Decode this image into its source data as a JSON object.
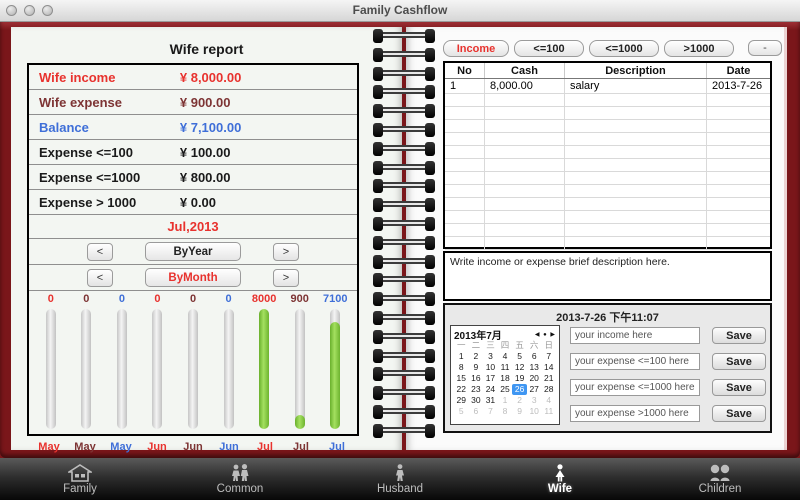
{
  "window": {
    "title": "Family Cashflow"
  },
  "left_page": {
    "title": "Wife report",
    "report_rows": [
      {
        "label": "Wife income",
        "value": "¥ 8,000.00",
        "color": "#e8322e"
      },
      {
        "label": "Wife expense",
        "value": "¥ 900.00",
        "color": "#7d3434"
      },
      {
        "label": "Balance",
        "value": "¥ 7,100.00",
        "color": "#3f6fd8"
      },
      {
        "label": "Expense  <=100",
        "value": "¥ 100.00",
        "color": "#1a1a1a"
      },
      {
        "label": "Expense  <=1000",
        "value": "¥ 800.00",
        "color": "#1a1a1a"
      },
      {
        "label": "Expense  > 1000",
        "value": "¥ 0.00",
        "color": "#1a1a1a"
      }
    ],
    "period_label": "Jul,2013",
    "by_year": {
      "prev": "<",
      "label": "ByYear",
      "next": ">"
    },
    "by_month": {
      "prev": "<",
      "label": "ByMonth",
      "next": ">"
    }
  },
  "chart_data": {
    "type": "bar",
    "categories": [
      "May",
      "May",
      "May",
      "Jun",
      "Jun",
      "Jun",
      "Jul",
      "Jul",
      "Jul"
    ],
    "roles": [
      "income",
      "expense",
      "balance",
      "income",
      "expense",
      "balance",
      "income",
      "expense",
      "balance"
    ],
    "values": [
      0,
      0,
      0,
      0,
      0,
      0,
      8000,
      900,
      7100
    ],
    "value_labels": [
      "0",
      "0",
      "0",
      "0",
      "0",
      "0",
      "8000",
      "900",
      "7100"
    ],
    "ylim": [
      0,
      8000
    ],
    "role_colors": {
      "income": "#e8322e",
      "expense": "#7d3434",
      "balance": "#3f6fd8"
    },
    "bar_fill_color": "#7dc63e",
    "track_color": "#d9d9d9",
    "legend_position": "none",
    "grid": false
  },
  "right_page": {
    "filter_buttons": [
      {
        "label": "Income",
        "active": true
      },
      {
        "label": "<=100",
        "active": false
      },
      {
        "label": "<=1000",
        "active": false
      },
      {
        "label": ">1000",
        "active": false
      }
    ],
    "minus_label": "-",
    "table": {
      "columns": [
        "No",
        "Cash",
        "Description",
        "Date"
      ],
      "rows": [
        [
          "1",
          "8,000.00",
          "salary",
          "2013-7-26"
        ]
      ],
      "empty_row_count": 12
    },
    "description_placeholder": "Write income or expense brief description here.",
    "timestamp": "2013-7-26 下午11:07",
    "calendar": {
      "title": "2013年7月",
      "nav": [
        "◀",
        "●",
        "▶"
      ],
      "weekdays": [
        "一",
        "二",
        "三",
        "四",
        "五",
        "六",
        "日"
      ],
      "days": [
        {
          "d": "1"
        },
        {
          "d": "2"
        },
        {
          "d": "3"
        },
        {
          "d": "4"
        },
        {
          "d": "5"
        },
        {
          "d": "6"
        },
        {
          "d": "7"
        },
        {
          "d": "8"
        },
        {
          "d": "9"
        },
        {
          "d": "10"
        },
        {
          "d": "11"
        },
        {
          "d": "12"
        },
        {
          "d": "13"
        },
        {
          "d": "14"
        },
        {
          "d": "15"
        },
        {
          "d": "16"
        },
        {
          "d": "17"
        },
        {
          "d": "18"
        },
        {
          "d": "19"
        },
        {
          "d": "20"
        },
        {
          "d": "21"
        },
        {
          "d": "22"
        },
        {
          "d": "23"
        },
        {
          "d": "24"
        },
        {
          "d": "25"
        },
        {
          "d": "26",
          "sel": true
        },
        {
          "d": "27"
        },
        {
          "d": "28"
        },
        {
          "d": "29"
        },
        {
          "d": "30"
        },
        {
          "d": "31"
        },
        {
          "d": "1",
          "out": true
        },
        {
          "d": "2",
          "out": true
        },
        {
          "d": "3",
          "out": true
        },
        {
          "d": "4",
          "out": true
        },
        {
          "d": "5",
          "out": true
        },
        {
          "d": "6",
          "out": true
        },
        {
          "d": "7",
          "out": true
        },
        {
          "d": "8",
          "out": true
        },
        {
          "d": "9",
          "out": true
        },
        {
          "d": "10",
          "out": true
        },
        {
          "d": "11",
          "out": true
        }
      ],
      "selected_day": "26"
    },
    "inputs": [
      {
        "name": "income-input",
        "placeholder": "your income here",
        "save_label": "Save"
      },
      {
        "name": "expense-100-input",
        "placeholder": "your expense <=100 here",
        "save_label": "Save"
      },
      {
        "name": "expense-1000-input",
        "placeholder": "your expense <=1000 here",
        "save_label": "Save"
      },
      {
        "name": "expense-gt1000-input",
        "placeholder": "your expense >1000 here",
        "save_label": "Save"
      }
    ]
  },
  "toolbar": {
    "items": [
      {
        "label": "Family",
        "icon": "house-icon",
        "active": false
      },
      {
        "label": "Common",
        "icon": "couple-icon",
        "active": false
      },
      {
        "label": "Husband",
        "icon": "man-icon",
        "active": false
      },
      {
        "label": "Wife",
        "icon": "woman-icon",
        "active": true
      },
      {
        "label": "Children",
        "icon": "children-icon",
        "active": false
      }
    ]
  }
}
